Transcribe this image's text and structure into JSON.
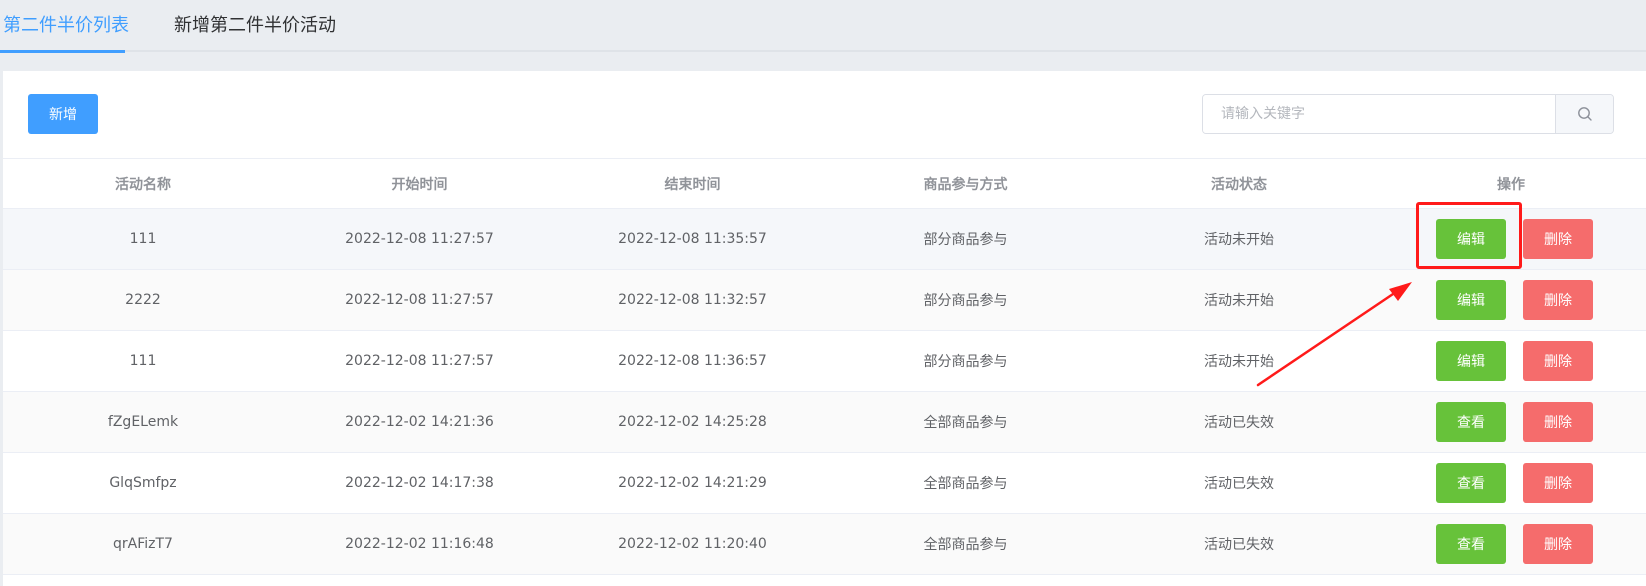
{
  "tabs": [
    {
      "label": "第二件半价列表",
      "active": true
    },
    {
      "label": "新增第二件半价活动",
      "active": false
    }
  ],
  "toolbar": {
    "add_label": "新增"
  },
  "search": {
    "placeholder": "请输入关键字",
    "value": "",
    "icon": "search-icon"
  },
  "table": {
    "headers": [
      "活动名称",
      "开始时间",
      "结束时间",
      "商品参与方式",
      "活动状态",
      "操作"
    ],
    "rows": [
      {
        "name": "111",
        "start": "2022-12-08 11:27:57",
        "end": "2022-12-08 11:35:57",
        "mode": "部分商品参与",
        "status": "活动未开始",
        "action": "编辑",
        "delete": "删除"
      },
      {
        "name": "2222",
        "start": "2022-12-08 11:27:57",
        "end": "2022-12-08 11:32:57",
        "mode": "部分商品参与",
        "status": "活动未开始",
        "action": "编辑",
        "delete": "删除"
      },
      {
        "name": "111",
        "start": "2022-12-08 11:27:57",
        "end": "2022-12-08 11:36:57",
        "mode": "部分商品参与",
        "status": "活动未开始",
        "action": "编辑",
        "delete": "删除"
      },
      {
        "name": "fZgELemk",
        "start": "2022-12-02 14:21:36",
        "end": "2022-12-02 14:25:28",
        "mode": "全部商品参与",
        "status": "活动已失效",
        "action": "查看",
        "delete": "删除"
      },
      {
        "name": "GlqSmfpz",
        "start": "2022-12-02 14:17:38",
        "end": "2022-12-02 14:21:29",
        "mode": "全部商品参与",
        "status": "活动已失效",
        "action": "查看",
        "delete": "删除"
      },
      {
        "name": "qrAFizT7",
        "start": "2022-12-02 11:16:48",
        "end": "2022-12-02 11:20:40",
        "mode": "全部商品参与",
        "status": "活动已失效",
        "action": "查看",
        "delete": "删除"
      }
    ]
  },
  "colors": {
    "primary": "#409eff",
    "success": "#67c23a",
    "danger": "#f56c6c",
    "annotation": "#ff1a1a"
  }
}
